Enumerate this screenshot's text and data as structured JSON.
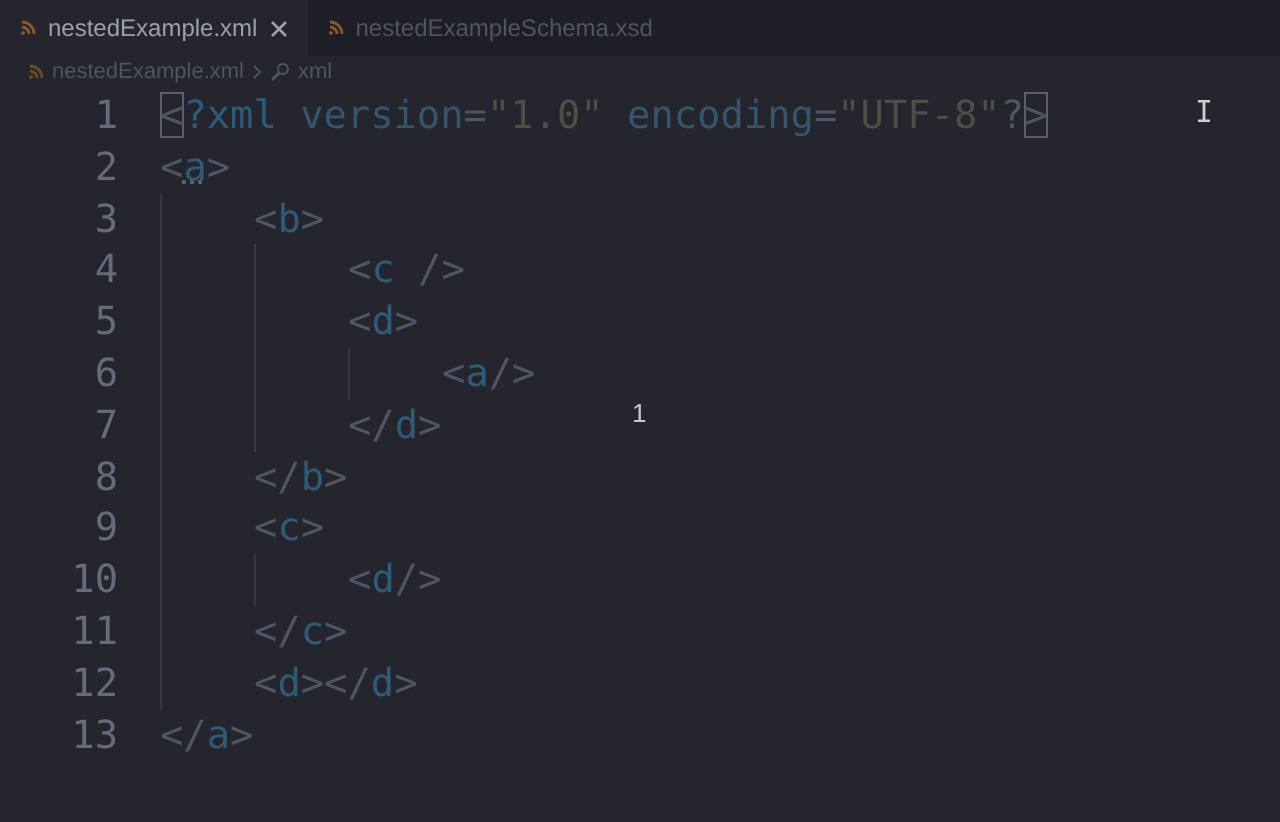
{
  "tabs": [
    {
      "label": "nestedExample.xml",
      "selected": true,
      "closable": true
    },
    {
      "label": "nestedExampleSchema.xsd",
      "selected": false,
      "closable": false
    }
  ],
  "breadcrumb": [
    {
      "label": "nestedExample.xml",
      "kind": "file"
    },
    {
      "label": "xml",
      "kind": "symbol"
    }
  ],
  "editor": {
    "lines": [
      {
        "number": "1",
        "tokens": [
          {
            "text": "<",
            "kind": "punct",
            "matched": true
          },
          {
            "text": "?xml",
            "kind": "tag"
          },
          {
            "text": " version",
            "kind": "attr"
          },
          {
            "text": "=",
            "kind": "punct"
          },
          {
            "text": "\"1.0\"",
            "kind": "string"
          },
          {
            "text": " encoding",
            "kind": "attr"
          },
          {
            "text": "=",
            "kind": "punct"
          },
          {
            "text": "\"UTF-8\"",
            "kind": "string"
          },
          {
            "text": "?",
            "kind": "punct"
          },
          {
            "text": ">",
            "kind": "punct",
            "matched": true
          }
        ]
      },
      {
        "number": "2",
        "tokens": [
          {
            "text": "<",
            "kind": "punct"
          },
          {
            "text": "a",
            "kind": "tag",
            "hinted": true
          },
          {
            "text": ">",
            "kind": "punct"
          }
        ]
      },
      {
        "number": "3",
        "tokens": [
          {
            "text": "    <",
            "kind": "punct"
          },
          {
            "text": "b",
            "kind": "tag"
          },
          {
            "text": ">",
            "kind": "punct"
          }
        ]
      },
      {
        "number": "4",
        "tokens": [
          {
            "text": "        <",
            "kind": "punct"
          },
          {
            "text": "c",
            "kind": "tag"
          },
          {
            "text": " />",
            "kind": "punct"
          }
        ]
      },
      {
        "number": "5",
        "tokens": [
          {
            "text": "        <",
            "kind": "punct"
          },
          {
            "text": "d",
            "kind": "tag"
          },
          {
            "text": ">",
            "kind": "punct"
          }
        ]
      },
      {
        "number": "6",
        "tokens": [
          {
            "text": "            <",
            "kind": "punct"
          },
          {
            "text": "a",
            "kind": "tag"
          },
          {
            "text": "/>",
            "kind": "punct"
          }
        ]
      },
      {
        "number": "7",
        "tokens": [
          {
            "text": "        </",
            "kind": "punct"
          },
          {
            "text": "d",
            "kind": "tag"
          },
          {
            "text": ">",
            "kind": "punct"
          }
        ]
      },
      {
        "number": "8",
        "tokens": [
          {
            "text": "    </",
            "kind": "punct"
          },
          {
            "text": "b",
            "kind": "tag"
          },
          {
            "text": ">",
            "kind": "punct"
          }
        ]
      },
      {
        "number": "9",
        "tokens": [
          {
            "text": "    <",
            "kind": "punct"
          },
          {
            "text": "c",
            "kind": "tag"
          },
          {
            "text": ">",
            "kind": "punct"
          }
        ]
      },
      {
        "number": "10",
        "tokens": [
          {
            "text": "        <",
            "kind": "punct"
          },
          {
            "text": "d",
            "kind": "tag"
          },
          {
            "text": "/>",
            "kind": "punct"
          }
        ]
      },
      {
        "number": "11",
        "tokens": [
          {
            "text": "    </",
            "kind": "punct"
          },
          {
            "text": "c",
            "kind": "tag"
          },
          {
            "text": ">",
            "kind": "punct"
          }
        ]
      },
      {
        "number": "12",
        "tokens": [
          {
            "text": "    <",
            "kind": "punct"
          },
          {
            "text": "d",
            "kind": "tag"
          },
          {
            "text": "></",
            "kind": "punct"
          },
          {
            "text": "d",
            "kind": "tag"
          },
          {
            "text": ">",
            "kind": "punct"
          }
        ]
      },
      {
        "number": "13",
        "tokens": [
          {
            "text": "</",
            "kind": "punct"
          },
          {
            "text": "a",
            "kind": "tag"
          },
          {
            "text": ">",
            "kind": "punct"
          }
        ]
      }
    ]
  },
  "overlay_text": "1"
}
